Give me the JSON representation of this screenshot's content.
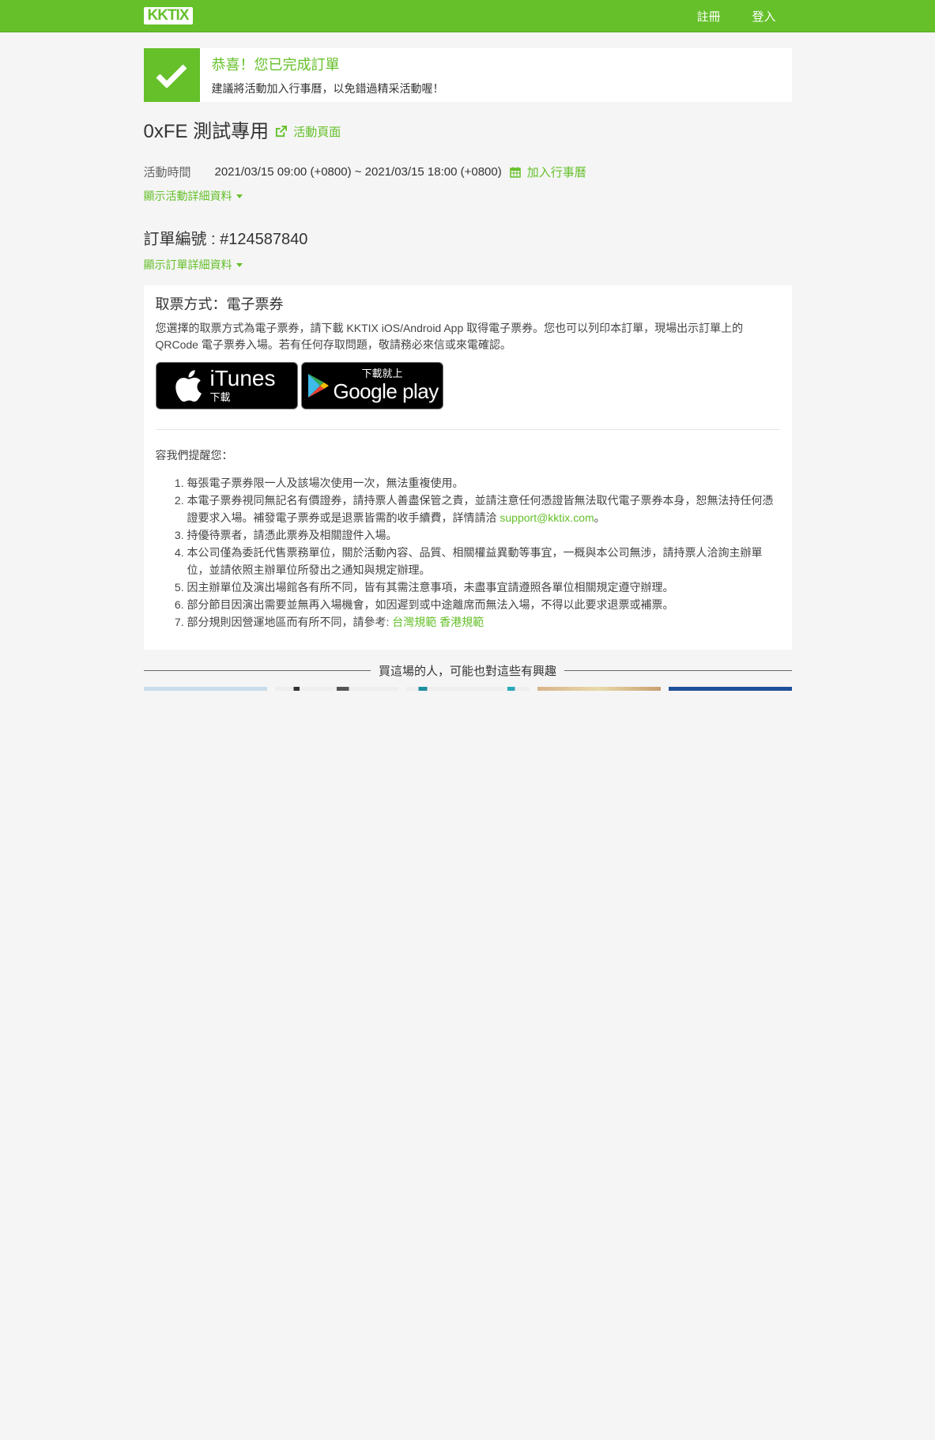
{
  "header": {
    "logo": "KKTIX",
    "nav": [
      "註冊",
      "登入"
    ]
  },
  "success": {
    "title": "恭喜！您已完成訂單",
    "subtitle": "建議將活動加入行事曆，以免錯過精采活動喔！"
  },
  "event": {
    "title": "0xFE 測試專用",
    "page_link": "活動頁面",
    "time_label": "活動時間",
    "time_value": "2021/03/15 09:00 (+0800) ~ 2021/03/15 18:00 (+0800)",
    "calendar_link": "加入行事曆",
    "details_toggle": "顯示活動詳細資料"
  },
  "order": {
    "number": "訂單編號 : #124587840",
    "details_toggle": "顯示訂單詳細資料"
  },
  "ticket": {
    "method": "取票方式：電子票券",
    "description": "您選擇的取票方式為電子票券，請下載 KKTIX iOS/Android App 取得電子票券。您也可以列印本訂單，現場出示訂單上的 QRCode 電子票券入場。若有任何存取問題，敬請務必來信或來電確認。",
    "itunes_big": "iTunes",
    "itunes_small": "下載",
    "gplay_small": "下載就上",
    "gplay_big": "Google play",
    "reminder_title": "容我們提醒您：",
    "reminders": [
      "每張電子票券限一人及該場次使用一次，無法重複使用。",
      "本電子票券視同無記名有價證券，請持票人善盡保管之責，並請注意任何憑證皆無法取代電子票券本身，恕無法持任何憑證要求入場。補發電子票券或是退票皆需酌收手續費，詳情請洽",
      "持優待票者，請憑此票券及相關證件入場。",
      "本公司僅為委託代售票務單位，關於活動內容、品質、相關權益異動等事宜，一概與本公司無涉，請持票人洽詢主辦單位，並請依照主辦單位所發出之通知與規定辦理。",
      "因主辦單位及演出場館各有所不同，皆有其需注意事項，未盡事宜請遵照各單位相關規定遵守辦理。",
      "部分節目因演出需要並無再入場機會，如因遲到或中途離席而無法入場，不得以此要求退票或補票。",
      "部分規則因營運地區而有所不同，請參考:"
    ],
    "support_email": "support@kktix.com",
    "support_suffix": "。",
    "taiwan_rules": "台灣規範",
    "hk_rules": "香港規範"
  },
  "recommend": {
    "title": "買這場的人，可能也對這些有興趣"
  },
  "colors": {
    "brand": "#65c02a"
  }
}
